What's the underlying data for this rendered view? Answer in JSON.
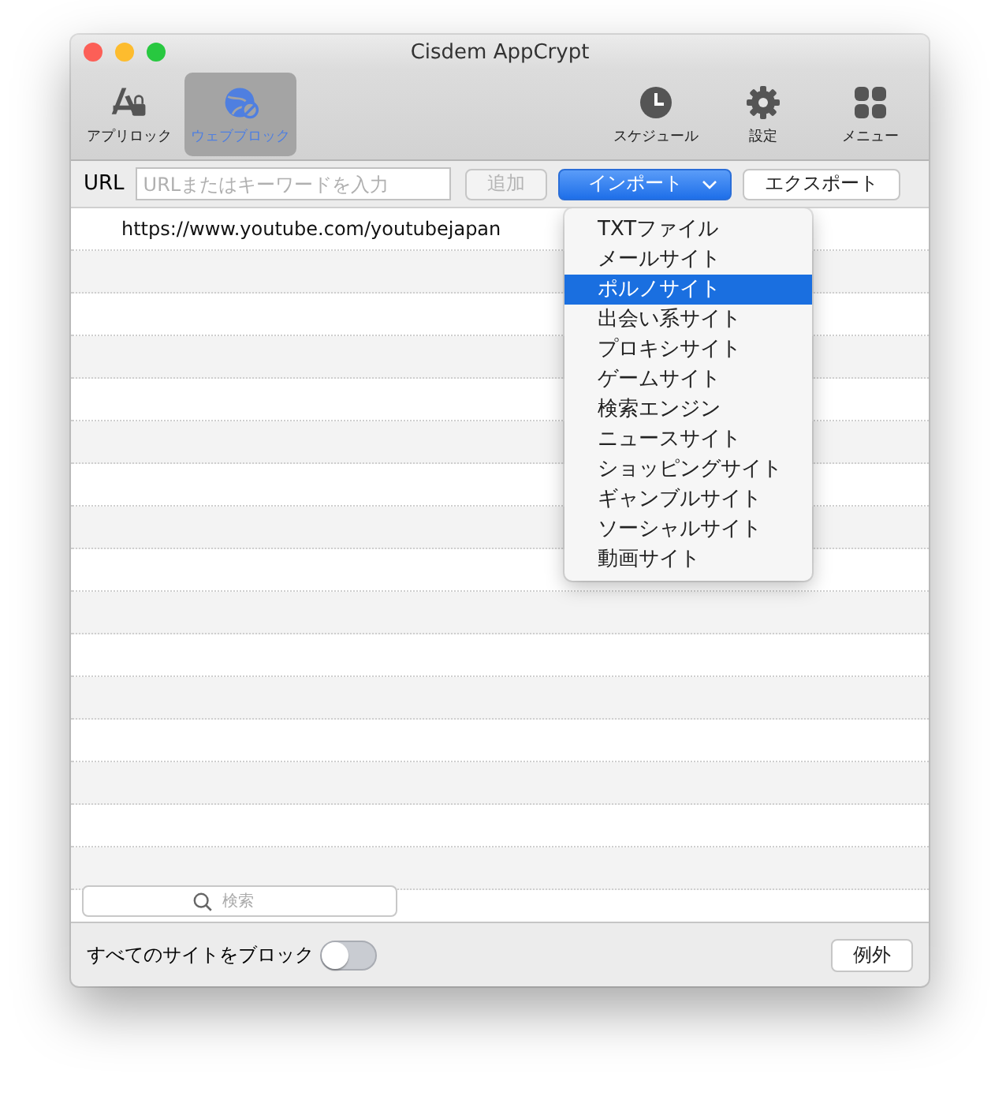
{
  "window": {
    "title": "Cisdem AppCrypt"
  },
  "toolbar": {
    "left": [
      {
        "label": "アプリロック",
        "kind": "applock",
        "selected": false
      },
      {
        "label": "ウェブブロック",
        "kind": "webblock",
        "selected": true
      }
    ],
    "right": [
      {
        "label": "スケジュール",
        "kind": "clock"
      },
      {
        "label": "設定",
        "kind": "gear"
      },
      {
        "label": "メニュー",
        "kind": "grid"
      }
    ]
  },
  "url_bar": {
    "label": "URL",
    "placeholder": "URLまたはキーワードを入力",
    "add_button": {
      "label": "追加",
      "disabled": true
    },
    "import_button": {
      "label": "インポート"
    },
    "export_button": {
      "label": "エクスポート"
    }
  },
  "import_menu": {
    "items": [
      {
        "label": "TXTファイル",
        "selected": false
      },
      {
        "label": "メールサイト",
        "selected": false
      },
      {
        "label": "ポルノサイト",
        "selected": true
      },
      {
        "label": "出会い系サイト",
        "selected": false
      },
      {
        "label": "プロキシサイト",
        "selected": false
      },
      {
        "label": "ゲームサイト",
        "selected": false
      },
      {
        "label": "検索エンジン",
        "selected": false
      },
      {
        "label": "ニュースサイト",
        "selected": false
      },
      {
        "label": "ショッピングサイト",
        "selected": false
      },
      {
        "label": "ギャンブルサイト",
        "selected": false
      },
      {
        "label": "ソーシャルサイト",
        "selected": false
      },
      {
        "label": "動画サイト",
        "selected": false
      }
    ]
  },
  "site_list": {
    "rows": [
      "https://www.youtube.com/youtubejapan"
    ]
  },
  "search": {
    "placeholder": "検索"
  },
  "footer": {
    "block_all_label": "すべてのサイトをブロック",
    "block_all_on": false,
    "exceptions_button": "例外"
  }
}
